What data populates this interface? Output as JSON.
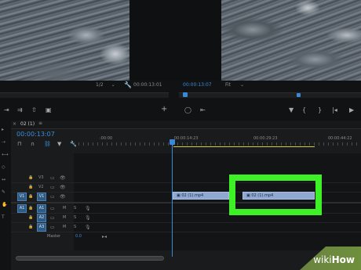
{
  "source_monitor": {
    "resolution": "1/2",
    "timecode": "00:00:13:01"
  },
  "program_monitor": {
    "timecode": "00:00:13:07",
    "fit": "Fit"
  },
  "timeline": {
    "tab_label": "02 (1)",
    "playhead_timecode": "00:00:13:07",
    "ruler_ticks": [
      ":00:00",
      "00:00:14:23",
      "00:00:29:23",
      "00:00:44:22"
    ],
    "tracks": {
      "video": [
        "V3",
        "V2",
        "V1"
      ],
      "audio": [
        "A1",
        "A2",
        "A3"
      ],
      "source_video": "V1",
      "source_audio": "A1",
      "mute": "M",
      "solo": "S",
      "master_label": "Master",
      "master_value": "0.0"
    },
    "clips": [
      {
        "name": "02 (1).mp4",
        "track": "V1"
      },
      {
        "name": "02 (1).mp4",
        "track": "V1"
      }
    ]
  },
  "watermark": {
    "prefix": "wiki",
    "suffix": "How"
  },
  "colors": {
    "accent": "#3a89d6",
    "highlight": "#3ef126",
    "clip": "#8ea8d2"
  }
}
